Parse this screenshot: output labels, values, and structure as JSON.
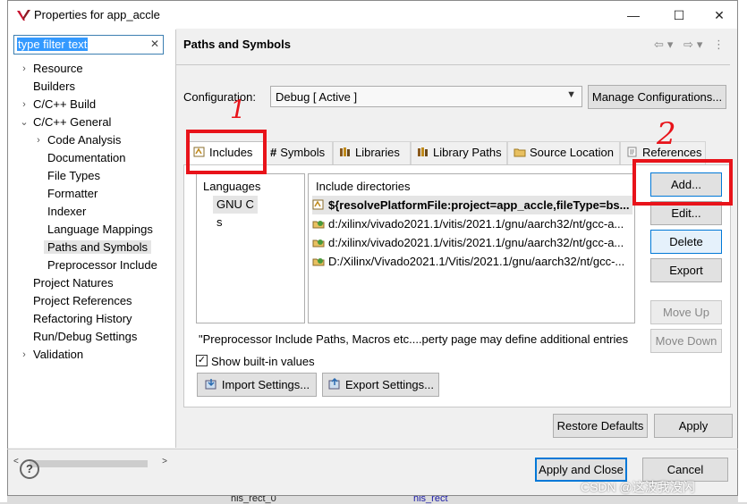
{
  "window": {
    "title": "Properties for app_accle"
  },
  "left": {
    "filter_value": "type filter text",
    "tree": [
      {
        "label": "Resource",
        "level": 0,
        "arrow": "right"
      },
      {
        "label": "Builders",
        "level": 0,
        "arrow": ""
      },
      {
        "label": "C/C++ Build",
        "level": 0,
        "arrow": "right"
      },
      {
        "label": "C/C++ General",
        "level": 0,
        "arrow": "down"
      },
      {
        "label": "Code Analysis",
        "level": 1,
        "arrow": "right"
      },
      {
        "label": "Documentation",
        "level": 1,
        "arrow": ""
      },
      {
        "label": "File Types",
        "level": 1,
        "arrow": ""
      },
      {
        "label": "Formatter",
        "level": 1,
        "arrow": ""
      },
      {
        "label": "Indexer",
        "level": 1,
        "arrow": ""
      },
      {
        "label": "Language Mappings",
        "level": 1,
        "arrow": ""
      },
      {
        "label": "Paths and Symbols",
        "level": 1,
        "arrow": "",
        "selected": true
      },
      {
        "label": "Preprocessor Include",
        "level": 1,
        "arrow": ""
      },
      {
        "label": "Project Natures",
        "level": 0,
        "arrow": ""
      },
      {
        "label": "Project References",
        "level": 0,
        "arrow": ""
      },
      {
        "label": "Refactoring History",
        "level": 0,
        "arrow": ""
      },
      {
        "label": "Run/Debug Settings",
        "level": 0,
        "arrow": ""
      },
      {
        "label": "Validation",
        "level": 0,
        "arrow": "right"
      }
    ]
  },
  "page": {
    "title": "Paths and Symbols",
    "config_label": "Configuration:",
    "config_value": "Debug  [ Active ]",
    "manage_configs": "Manage Configurations...",
    "tabs": [
      "Includes",
      "Symbols",
      "Libraries",
      "Library Paths",
      "Source Location",
      "References"
    ],
    "languages_header": "Languages",
    "languages": [
      "GNU C",
      "s"
    ],
    "dirs_header": "Include directories",
    "dirs": [
      "${resolvePlatformFile:project=app_accle,fileType=bs...",
      "d:/xilinx/vivado2021.1/vitis/2021.1/gnu/aarch32/nt/gcc-a...",
      "d:/xilinx/vivado2021.1/vitis/2021.1/gnu/aarch32/nt/gcc-a...",
      "D:/Xilinx/Vivado2021.1/Vitis/2021.1/gnu/aarch32/nt/gcc-..."
    ],
    "buttons": {
      "add": "Add...",
      "edit": "Edit...",
      "delete": "Delete",
      "export": "Export",
      "move_up": "Move Up",
      "move_down": "Move Down"
    },
    "note": "\"Preprocessor Include Paths, Macros etc....perty page may define additional entries",
    "show_builtin": "Show built-in values",
    "import_settings": "Import Settings...",
    "export_settings": "Export Settings...",
    "restore_defaults": "Restore Defaults",
    "apply": "Apply"
  },
  "footer": {
    "apply_close": "Apply and Close",
    "cancel": "Cancel"
  },
  "annotations": [
    "1",
    "2"
  ],
  "watermark": "CSDN @这波我没闪",
  "background": {
    "bottom_left": "his_rect_0",
    "bottom_mid": "his_rect"
  },
  "colors": {
    "annotation": "#e8131a",
    "selection": "#3399ff"
  }
}
